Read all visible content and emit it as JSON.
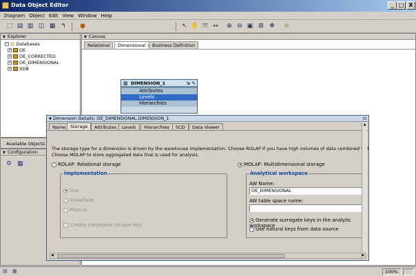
{
  "window": {
    "title": "Data Object Editor",
    "minimize": "_",
    "maximize": "□",
    "close": "X"
  },
  "menu": [
    "Diagram",
    "Object",
    "Edit",
    "View",
    "Window",
    "Help"
  ],
  "explorer": {
    "title": "Explorer",
    "tree_root": "Databases",
    "items": [
      "OE",
      "OE_CORRECTED",
      "OE_DIMENSIONAL",
      "XDB"
    ]
  },
  "available_objects": {
    "label": "Available Objects"
  },
  "configuration": {
    "title": "Configuration"
  },
  "canvas": {
    "title": "Canvas",
    "tabs": [
      "Relational",
      "Dimensional",
      "Business Definition"
    ],
    "active_tab": "Dimensional",
    "tab_close": "×"
  },
  "dimension_box": {
    "title": "DIMENSION_1",
    "items": [
      "Attributes",
      "Levels",
      "Hierarchies"
    ],
    "selected": "Levels"
  },
  "details": {
    "title": "Dimension Details: OE_DIMENSIONAL.DIMENSION_1",
    "tabs": [
      "Name",
      "Storage",
      "Attributes",
      "Levels",
      "Hierarchies",
      "SCD",
      "Data Viewer"
    ],
    "active_tab": "Storage",
    "description_line1": "The storage type for a dimension is driven by the warehouse implementation. Choose ROLAP if you have high volumes of data combined with high refresh rat",
    "description_line2": "Choose MOLAP to store aggregated data that is used for analysis.",
    "rolap_label": "ROLAP: Relational storage",
    "molap_label": "MOLAP: Multidimensional storage",
    "molap_selected": true,
    "implementation": {
      "title": "Implementation",
      "options": [
        "Star",
        "Snowflake",
        "Manual"
      ],
      "composite_key_label": "Create composite Unique Key"
    },
    "analytical": {
      "title": "Analytical workspace",
      "aw_name_label": "AW Name:",
      "aw_name_value": "OE_DIMENSIONAL",
      "aw_tablespace_label": "AW table space name:",
      "aw_tablespace_value": "",
      "surrogate_label": "Generate surrogate keys in the analytic workspace",
      "natural_label": "Use natural keys from data source",
      "surrogate_selected": true
    }
  },
  "status": {
    "zoom": "100%"
  }
}
